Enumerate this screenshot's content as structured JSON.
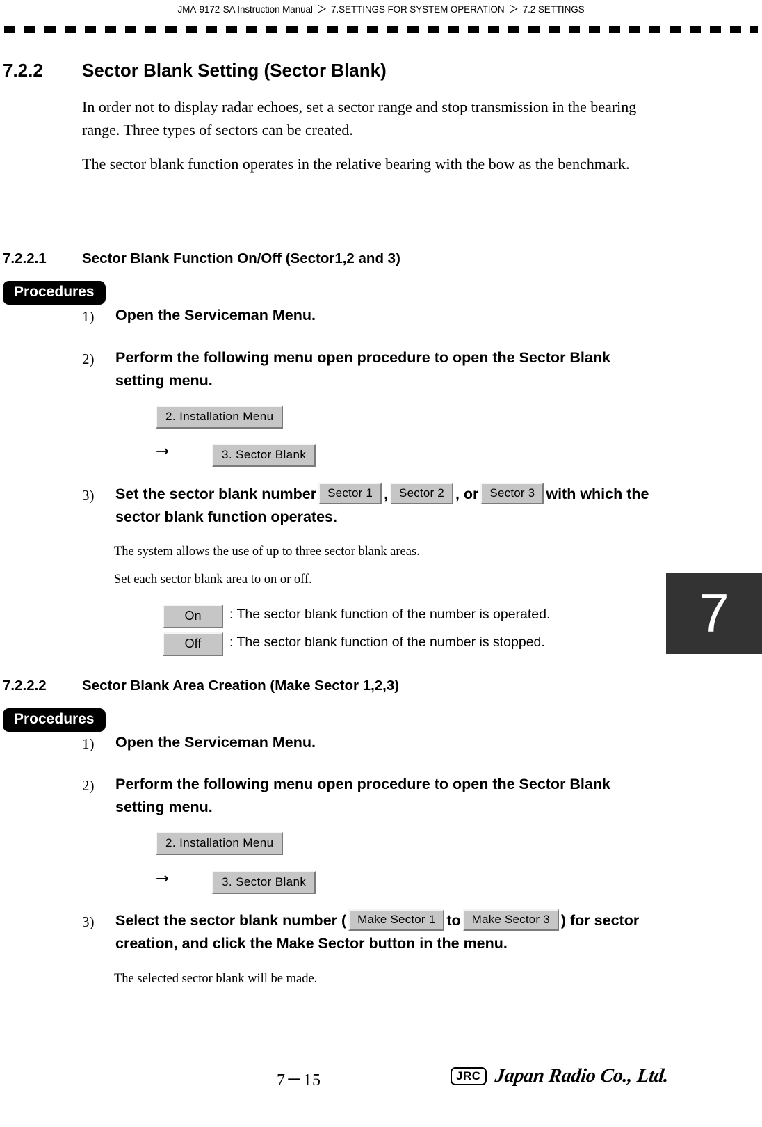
{
  "header": {
    "breadcrumb_parts": [
      "JMA-9172-SA Instruction Manual",
      "7.SETTINGS FOR SYSTEM OPERATION",
      "7.2  SETTINGS"
    ],
    "separator": "＞"
  },
  "chapter_tab": {
    "number": "7",
    "bg_color": "#333333",
    "text_color": "#ffffff"
  },
  "section": {
    "number": "7.2.2",
    "title": "Sector Blank Setting (Sector Blank)",
    "paragraph_1": "In order not to display radar echoes, set a sector range and stop transmission in the bearing range. Three types of sectors can be created.",
    "paragraph_2": "The sector blank function operates in the relative bearing with the bow as the benchmark."
  },
  "subsection_1": {
    "number": "7.2.2.1",
    "title": "Sector Blank Function On/Off (Sector1,2 and 3)",
    "procedures_label": "Procedures",
    "step1": {
      "num": "1)",
      "text": "Open the Serviceman Menu."
    },
    "step2": {
      "num": "2)",
      "text": "Perform the following menu open procedure to open the Sector Blank setting menu.",
      "menu_button_1": "2. Installation Menu",
      "arrow": "→",
      "menu_button_2": "3. Sector Blank"
    },
    "step3": {
      "num": "3)",
      "text_before": "Set the sector blank number",
      "button_sector1": "Sector 1",
      "sep1": ",",
      "button_sector2": "Sector 2",
      "sep2": ", or",
      "button_sector3": "Sector 3",
      "text_after": "with",
      "text_line2": "which the sector blank function operates.",
      "note_1": "The system allows the use of up to three sector blank areas.",
      "note_2": "Set each sector blank area to on or off.",
      "on_button": "On",
      "on_desc": ":  The sector blank function of the number is operated.",
      "off_button": "Off",
      "off_desc": ":  The sector blank function of the number is stopped."
    }
  },
  "subsection_2": {
    "number": "7.2.2.2",
    "title": "Sector Blank Area Creation (Make Sector 1,2,3)",
    "procedures_label": "Procedures",
    "step1": {
      "num": "1)",
      "text": "Open the Serviceman Menu."
    },
    "step2": {
      "num": "2)",
      "text": "Perform the following menu open procedure to open the Sector Blank setting menu.",
      "menu_button_1": "2. Installation Menu",
      "arrow": "→",
      "menu_button_2": "3. Sector Blank"
    },
    "step3": {
      "num": "3)",
      "text_before": "Select the sector blank number (",
      "button_make1": "Make Sector 1",
      "mid_text": "to",
      "button_make3": "Make Sector 3",
      "text_after": ") for",
      "text_line2": "sector creation, and click the Make Sector  button in the menu.",
      "note": "The selected sector blank will be made."
    }
  },
  "footer": {
    "page_number": "7－15",
    "logo_mark": "JRC",
    "logo_name": "Japan Radio Co., Ltd."
  }
}
